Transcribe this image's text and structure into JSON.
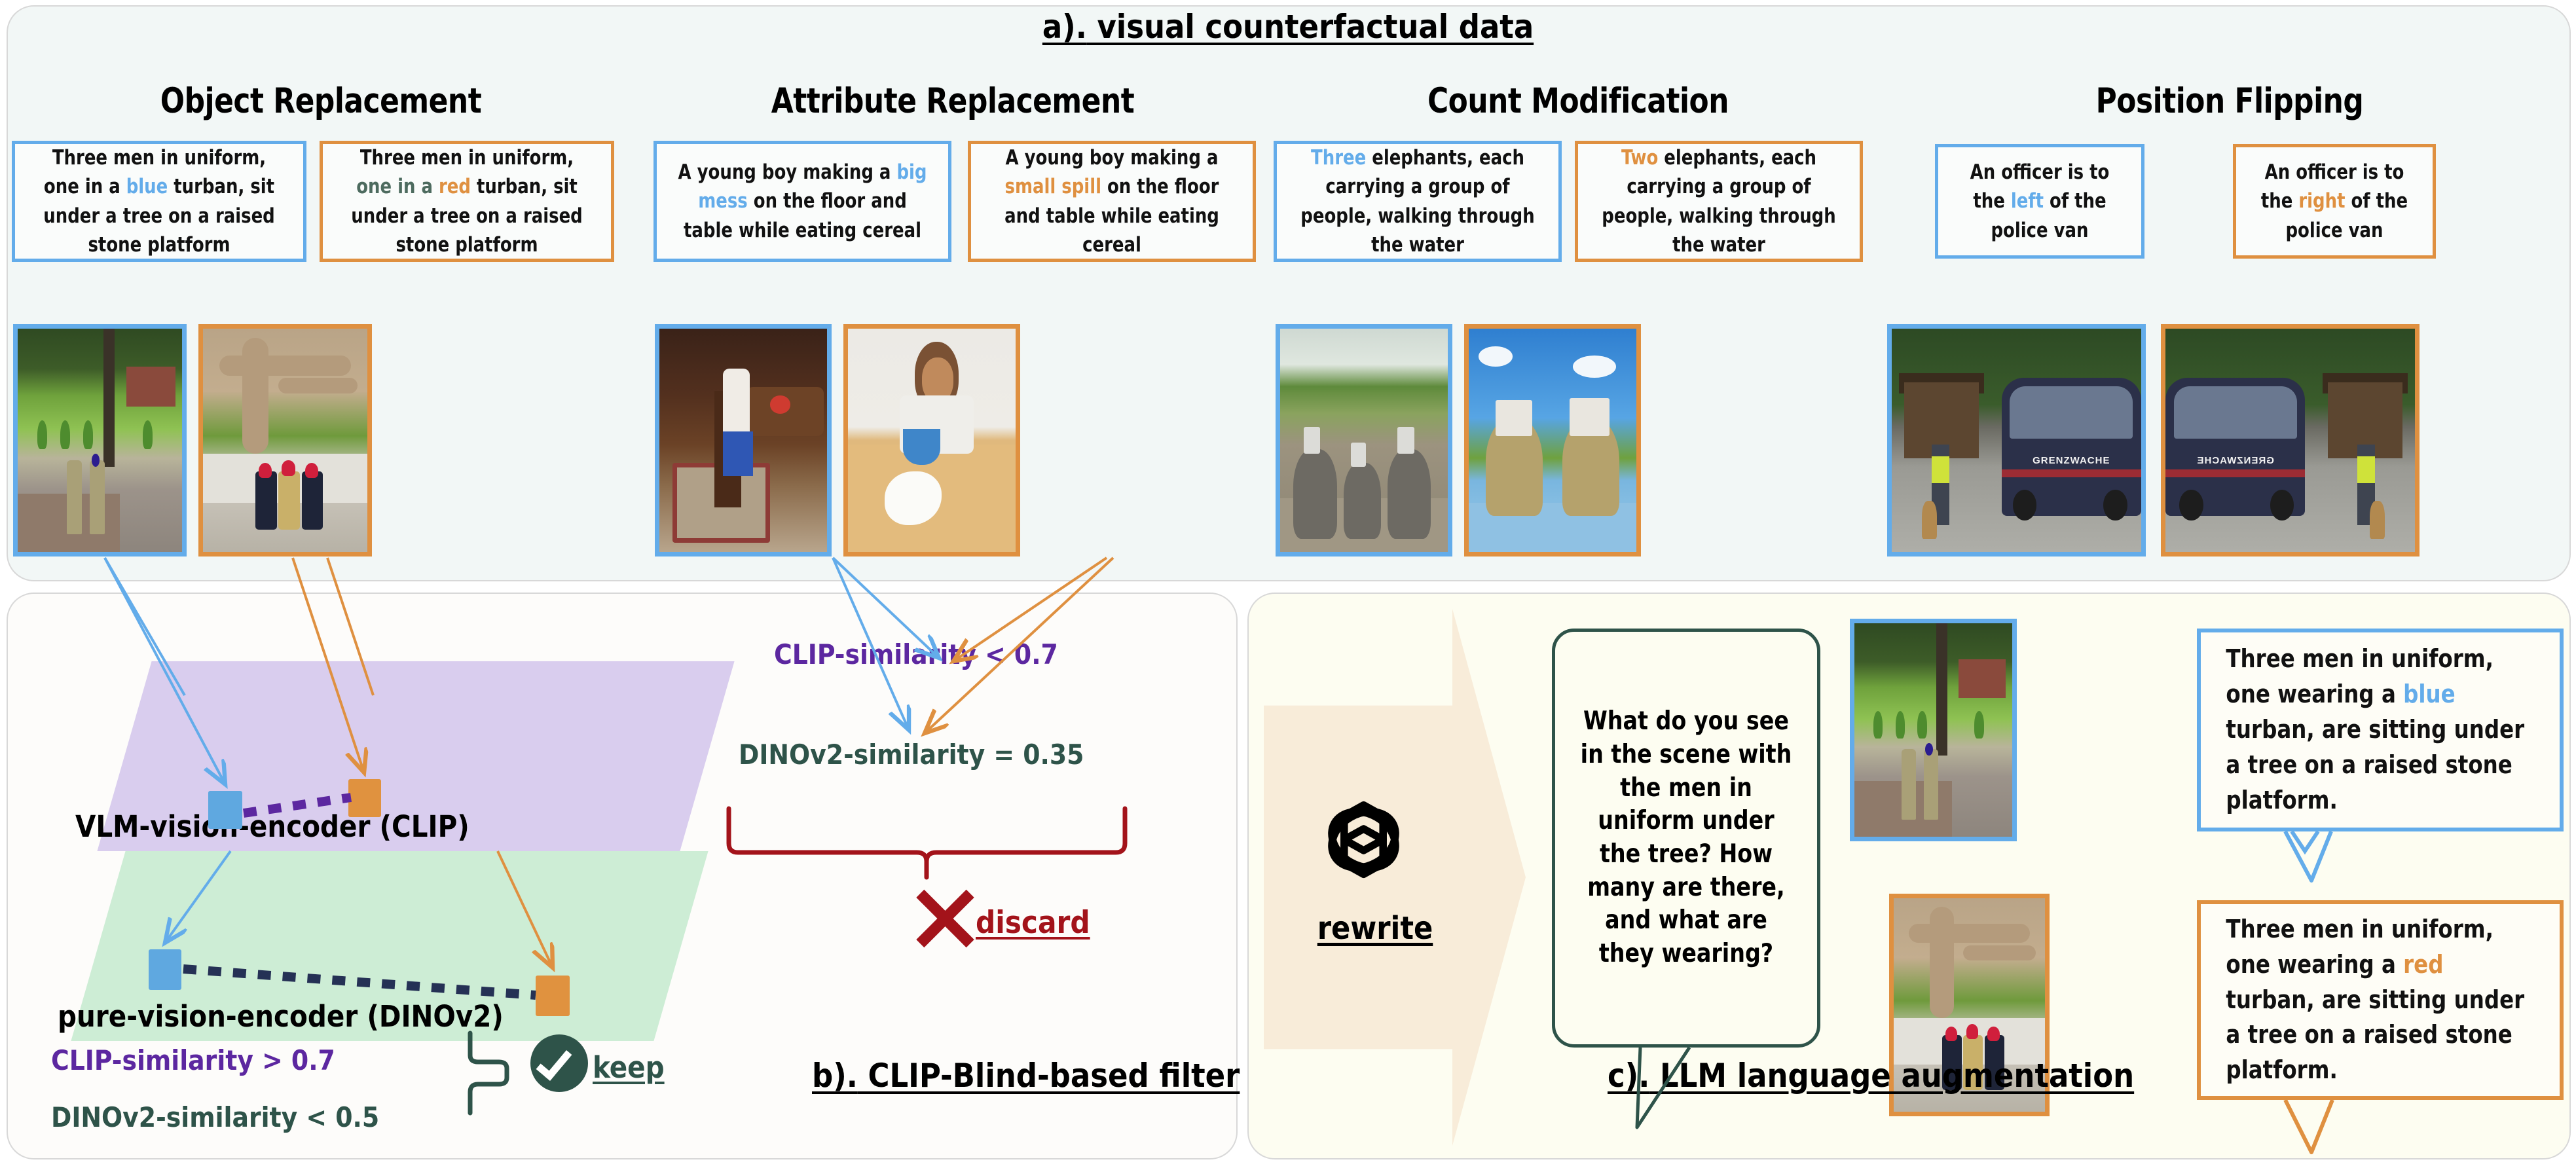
{
  "sections": {
    "a": {
      "lead": "a).",
      "label": " visual counterfactual data"
    },
    "b": {
      "lead": "b).",
      "label": " CLIP-Blind-based filter"
    },
    "c": {
      "lead": "c).",
      "label": " LLM language augmentation"
    }
  },
  "columns": [
    {
      "title": "Object Replacement",
      "original": {
        "pre": "Three men in uniform, one in a ",
        "highlight": "blue",
        "post": " turban, sit under a tree on a raised stone platform"
      },
      "counterfactual": {
        "pre": "Three men in uniform, ",
        "mid_grey": "one in a ",
        "highlight": "red",
        "post": " turban, sit under a tree on a raised stone platform"
      }
    },
    {
      "title": "Attribute Replacement",
      "original": {
        "pre": "A young boy making a ",
        "highlight": "big mess",
        "post": " on the floor and table while eating cereal"
      },
      "counterfactual": {
        "pre": "A young boy making a ",
        "highlight": "small spill",
        "post": " on the floor and table while eating cereal"
      }
    },
    {
      "title": "Count Modification",
      "original": {
        "highlight": "Three",
        "post": " elephants, each carrying a group of people, walking through the water"
      },
      "counterfactual": {
        "highlight": "Two",
        "post": " elephants, each carrying a group of people, walking through the water"
      }
    },
    {
      "title": "Position Flipping",
      "original": {
        "pre": "An officer is to the ",
        "highlight": "left",
        "post": " of the police van"
      },
      "counterfactual": {
        "pre": "An officer is to the ",
        "highlight": "right",
        "post": " of the police van"
      }
    }
  ],
  "filter": {
    "clip_plane_label": "VLM-vision-encoder (CLIP)",
    "dino_plane_label": "pure-vision-encoder (DINOv2)",
    "keep_criteria": {
      "clip": "CLIP-similarity > 0.7",
      "dino": "DINOv2-similarity < 0.5",
      "verdict": "keep"
    },
    "discard_criteria": {
      "clip": "CLIP-similarity < 0.7",
      "dino": "DINOv2-similarity = 0.35",
      "verdict": "discard"
    }
  },
  "augment": {
    "rewrite_label": "rewrite",
    "prompt": "What do you see in the scene with the men in uniform under the tree? How many are there, and what are they wearing?",
    "results": [
      {
        "pre": "Three men in uniform, one wearing a ",
        "highlight": "blue",
        "post": " turban, are sitting under a tree on a raised stone platform."
      },
      {
        "pre": "Three men in uniform, one wearing a ",
        "highlight": "red",
        "post": " turban, are sitting under a tree on a raised stone platform."
      }
    ]
  },
  "images": {
    "van_text": "GRENZWACHE"
  },
  "colors": {
    "blue": "#63acea",
    "orange": "#df9040",
    "purple": "#5c27a0",
    "green": "#2e5349",
    "red": "#a3131a"
  }
}
